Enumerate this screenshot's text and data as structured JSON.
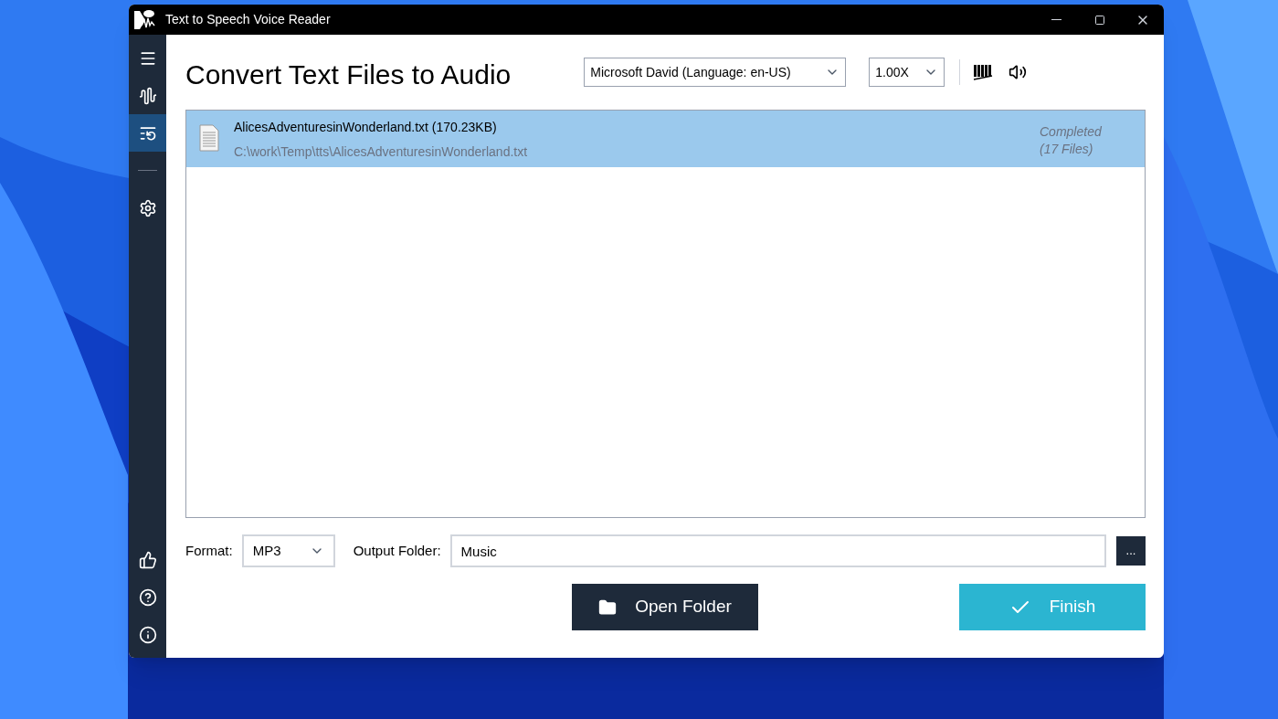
{
  "window": {
    "title": "Text to Speech Voice Reader"
  },
  "sidebar": {
    "top_items": [
      {
        "kind": "menu",
        "selected": false
      },
      {
        "kind": "voice",
        "selected": false
      },
      {
        "kind": "convert",
        "selected": true
      },
      {
        "kind": "settings",
        "selected": false
      }
    ],
    "bottom_items": [
      {
        "kind": "like",
        "selected": false
      },
      {
        "kind": "help",
        "selected": false
      },
      {
        "kind": "info",
        "selected": false
      }
    ]
  },
  "page_title": "Convert Text Files to Audio",
  "voice_select": {
    "value": "Microsoft David (Language: en-US)"
  },
  "speed_select": {
    "value": "1.00X"
  },
  "files": [
    {
      "name": "AlicesAdventuresinWonderland.txt (170.23KB)",
      "path": "C:\\work\\Temp\\tts\\AlicesAdventuresinWonderland.txt",
      "status": "Completed",
      "count": "(17 Files)",
      "selected": true
    }
  ],
  "format": {
    "label": "Format:",
    "value": "MP3"
  },
  "output_folder": {
    "label": "Output Folder:",
    "value": "Music",
    "browse": "..."
  },
  "buttons": [
    {
      "kind": "open",
      "label": "Open Folder"
    },
    {
      "kind": "finish",
      "label": "Finish"
    }
  ]
}
